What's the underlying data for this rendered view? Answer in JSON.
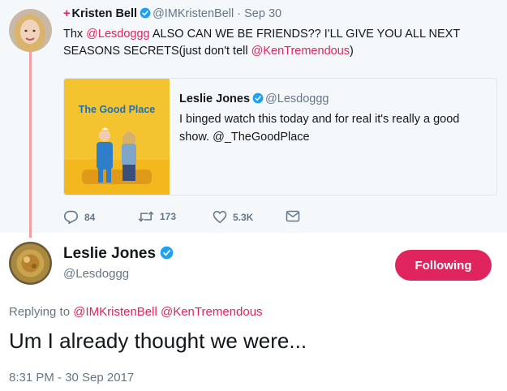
{
  "tweet1": {
    "plus": "+",
    "name": "Kristen Bell",
    "handle": "@IMKristenBell",
    "separator": "·",
    "date": "Sep 30",
    "text_thx": "Thx ",
    "mention1": "@Lesdoggg",
    "text_mid": " ALSO CAN WE BE FRIENDS?? I'LL GIVE YOU ALL NEXT SEASONS SECRETS(just don't tell ",
    "mention2": "@KenTremendous",
    "text_end": ")"
  },
  "quote": {
    "image_title": "The Good Place",
    "name": "Leslie Jones",
    "handle": "@Lesdoggg",
    "text": "I binged watch this today and for real it's really a good show. @_TheGoodPlace"
  },
  "actions": {
    "reply_count": "84",
    "retweet_count": "173",
    "like_count": "5.3K"
  },
  "main": {
    "name": "Leslie Jones",
    "handle": "@Lesdoggg",
    "follow_label": "Following",
    "replying_prefix": "Replying to ",
    "replying_mention1": "@IMKristenBell",
    "replying_space": " ",
    "replying_mention2": "@KenTremendous",
    "text": "Um I already thought we were...",
    "timestamp": "8:31 PM - 30 Sep 2017"
  },
  "colors": {
    "accent": "#e0245e",
    "verified": "#1da1f2",
    "secondary_text": "#657786",
    "thread_line": "#f0a0a8"
  },
  "icons": [
    "verified-badge-icon",
    "reply-icon",
    "retweet-icon",
    "heart-icon",
    "direct-message-icon"
  ]
}
